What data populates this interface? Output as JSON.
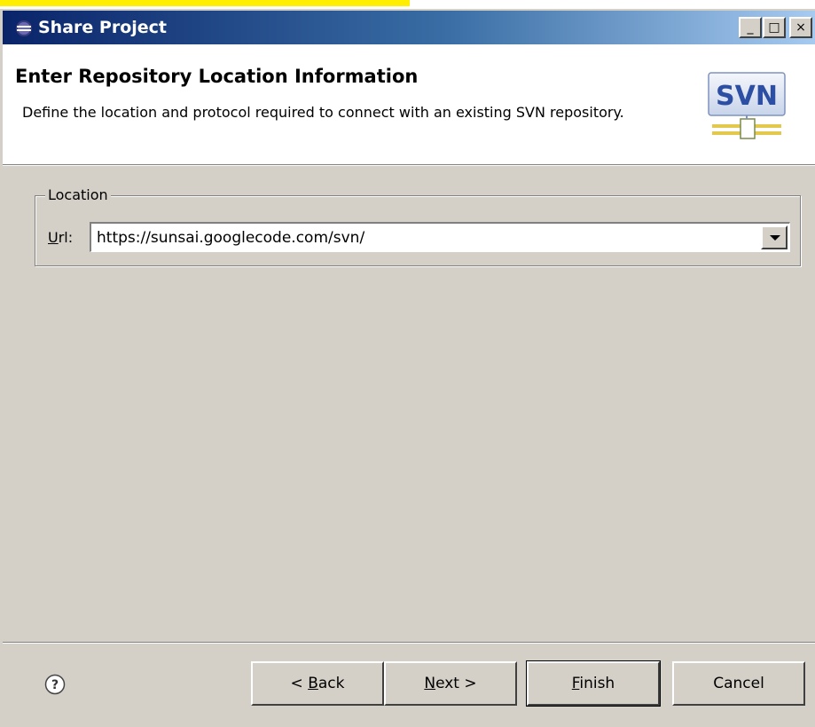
{
  "window": {
    "title": "Share Project",
    "controls": {
      "minimize": "_",
      "maximize": "□",
      "close": "×"
    }
  },
  "header": {
    "title": "Enter Repository Location Information",
    "description": "Define the location and protocol required to connect with an existing SVN repository.",
    "logo_text": "SVN"
  },
  "location": {
    "legend": "Location",
    "url_label_prefix": "U",
    "url_label_rest": "rl:",
    "url_value": "https://sunsai.googlecode.com/svn/"
  },
  "footer": {
    "help_glyph": "?",
    "back": {
      "pre": "< ",
      "acc": "B",
      "post": "ack"
    },
    "next": {
      "pre": "",
      "acc": "N",
      "post": "ext >"
    },
    "finish": {
      "pre": "",
      "acc": "F",
      "post": "inish"
    },
    "cancel": "Cancel"
  },
  "colors": {
    "face": "#d4d0c8",
    "title_start": "#0a246a",
    "title_end": "#a6caf0",
    "highlight_strip": "#ffee00"
  }
}
